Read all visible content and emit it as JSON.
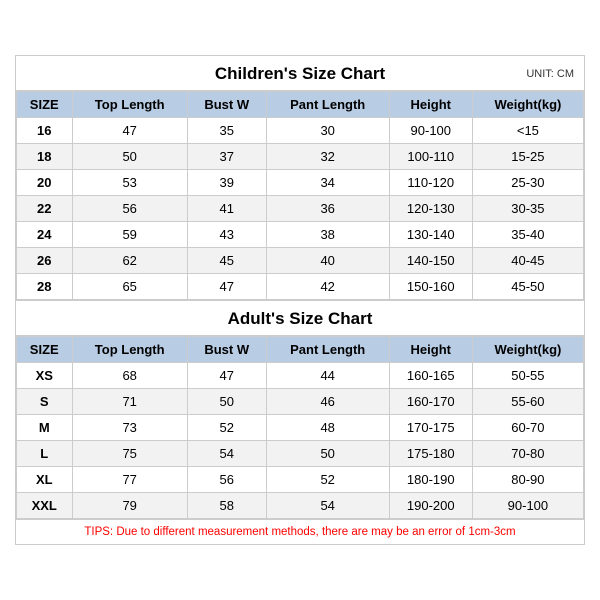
{
  "children_title": "Children's Size Chart",
  "adult_title": "Adult's Size Chart",
  "unit": "UNIT: CM",
  "tips": "TIPS: Due to different measurement methods, there are may be an error of 1cm-3cm",
  "headers": [
    "SIZE",
    "Top Length",
    "Bust W",
    "Pant Length",
    "Height",
    "Weight(kg)"
  ],
  "children_rows": [
    [
      "16",
      "47",
      "35",
      "30",
      "90-100",
      "<15"
    ],
    [
      "18",
      "50",
      "37",
      "32",
      "100-110",
      "15-25"
    ],
    [
      "20",
      "53",
      "39",
      "34",
      "110-120",
      "25-30"
    ],
    [
      "22",
      "56",
      "41",
      "36",
      "120-130",
      "30-35"
    ],
    [
      "24",
      "59",
      "43",
      "38",
      "130-140",
      "35-40"
    ],
    [
      "26",
      "62",
      "45",
      "40",
      "140-150",
      "40-45"
    ],
    [
      "28",
      "65",
      "47",
      "42",
      "150-160",
      "45-50"
    ]
  ],
  "adult_rows": [
    [
      "XS",
      "68",
      "47",
      "44",
      "160-165",
      "50-55"
    ],
    [
      "S",
      "71",
      "50",
      "46",
      "160-170",
      "55-60"
    ],
    [
      "M",
      "73",
      "52",
      "48",
      "170-175",
      "60-70"
    ],
    [
      "L",
      "75",
      "54",
      "50",
      "175-180",
      "70-80"
    ],
    [
      "XL",
      "77",
      "56",
      "52",
      "180-190",
      "80-90"
    ],
    [
      "XXL",
      "79",
      "58",
      "54",
      "190-200",
      "90-100"
    ]
  ]
}
